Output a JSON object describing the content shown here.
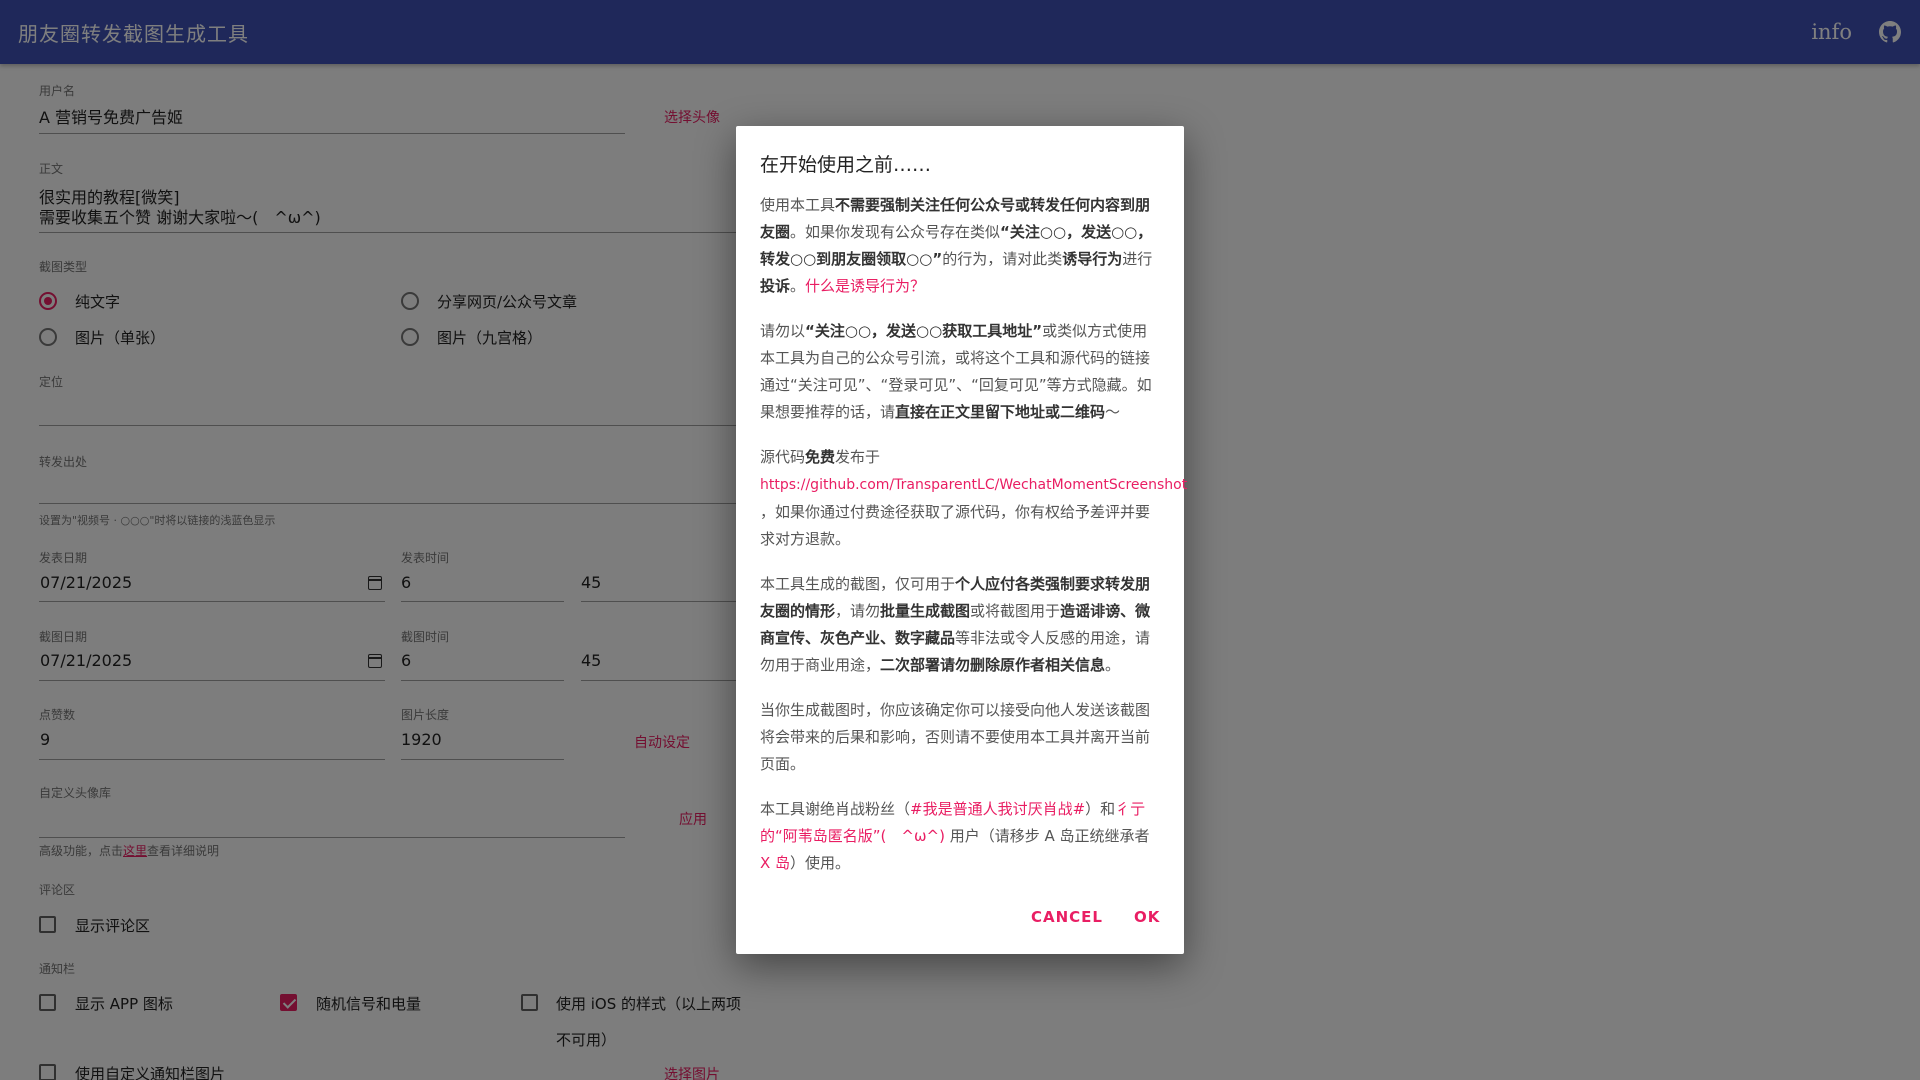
{
  "appbar": {
    "title": "朋友圈转发截图生成工具",
    "info_label": "info",
    "github_icon": "github-icon"
  },
  "form": {
    "username": {
      "label": "用户名",
      "value": "A 营销号免费广告姬",
      "action": "选择头像"
    },
    "content": {
      "label": "正文",
      "line1": "很实用的教程[微笑]",
      "line2": "需要收集五个赞 谢谢大家啦～(　^ω^)"
    },
    "screenshot_type": {
      "label": "截图类型",
      "options": [
        {
          "label": "纯文字",
          "checked": true
        },
        {
          "label": "分享网页/公众号文章",
          "checked": false
        },
        {
          "label": "图片（单张）",
          "checked": false
        },
        {
          "label": "图片（九宫格）",
          "checked": false
        }
      ]
    },
    "location": {
      "label": "定位",
      "value": ""
    },
    "forward_source": {
      "label": "转发出处",
      "value": "",
      "helper": "设置为\"视频号 · ○○○\"时将以链接的浅蓝色显示"
    },
    "post_date": {
      "label": "发表日期",
      "value": "07/21/2025"
    },
    "post_time": {
      "label": "发表时间",
      "hour": "6",
      "minute": "45"
    },
    "shot_date": {
      "label": "截图日期",
      "value": "07/21/2025"
    },
    "shot_time": {
      "label": "截图时间",
      "hour": "6",
      "minute": "45"
    },
    "likes": {
      "label": "点赞数",
      "value": "9"
    },
    "image_length": {
      "label": "图片长度",
      "value": "1920",
      "action": "自动设定"
    },
    "custom_avatars": {
      "label": "自定义头像库",
      "value": "",
      "action": "应用",
      "helper_before": "高级功能，点击",
      "helper_link": "这里",
      "helper_after": "查看详细说明"
    },
    "comments": {
      "label": "评论区",
      "option": "显示评论区",
      "checked": false
    },
    "notification_bar": {
      "label": "通知栏",
      "options": [
        {
          "label": "显示 APP 图标",
          "checked": false
        },
        {
          "label": "随机信号和电量",
          "checked": true
        },
        {
          "label": "使用 iOS 的样式（以上两项",
          "label2": "不可用）",
          "checked": false
        }
      ],
      "custom_image": {
        "label": "使用自定义通知栏图片",
        "checked": false,
        "action": "选择图片"
      }
    }
  },
  "dialog": {
    "title": "在开始使用之前……",
    "p1": {
      "t1": "使用本工具",
      "b1": "不需要强制关注任何公众号或转发任何内容到朋友圈",
      "t2": "。如果你发现有公众号存在类似",
      "b2": "“关注○○，发送○○，转发○○到朋友圈领取○○”",
      "t3": "的行为，请对此类",
      "b3": "诱导行为",
      "t4": "进行",
      "b4": "投诉",
      "t5": "。",
      "link": "什么是诱导行为？"
    },
    "p2": {
      "t1": "请勿以",
      "b1": "“关注○○，发送○○获取工具地址”",
      "t2": "或类似方式使用本工具为自己的公众号引流，或将这个工具和源代码的链接通过“关注可见”、“登录可见”、“回复可见”等方式隐藏。如果想要推荐的话，请",
      "b2": "直接在正文里留下地址或二维码",
      "t3": "～"
    },
    "p3": {
      "t1": "源代码",
      "b1": "免费",
      "t2": "发布于",
      "url": "https://github.com/TransparentLC/WechatMomentScreenshot",
      "t3": "，如果你通过付费途径获取了源代码，你有权给予差评并要求对方退款。"
    },
    "p4": {
      "t1": "本工具生成的截图，仅可用于",
      "b1": "个人应付各类强制要求转发朋友圈的情形",
      "t2": "，请勿",
      "b2": "批量生成截图",
      "t3": "或将截图用于",
      "b3": "造谣诽谤、微商宣传、灰色产业、数字藏品",
      "t4": "等非法或令人反感的用途，请勿用于商业用途，",
      "b4": "二次部署请勿删除原作者相关信息",
      "t5": "。"
    },
    "p5": "当你生成截图时，你应该确定你可以接受向他人发送该截图将会带来的后果和影响，否则请不要使用本工具并离开当前页面。",
    "p6": {
      "t1": "本工具谢绝肖战粉丝（",
      "link1": "#我是普通人我讨厌肖战#",
      "t2": "）和",
      "link2": "彳亍的“阿苇岛匿名版”(　^ω^)",
      "t3": " 用户（请移步 A 岛正统继承者 ",
      "link3": "X 岛",
      "t4": "）使用。"
    },
    "cancel": "CANCEL",
    "ok": "OK"
  },
  "colors": {
    "primary": "#3f51b5",
    "accent": "#e91e63"
  }
}
